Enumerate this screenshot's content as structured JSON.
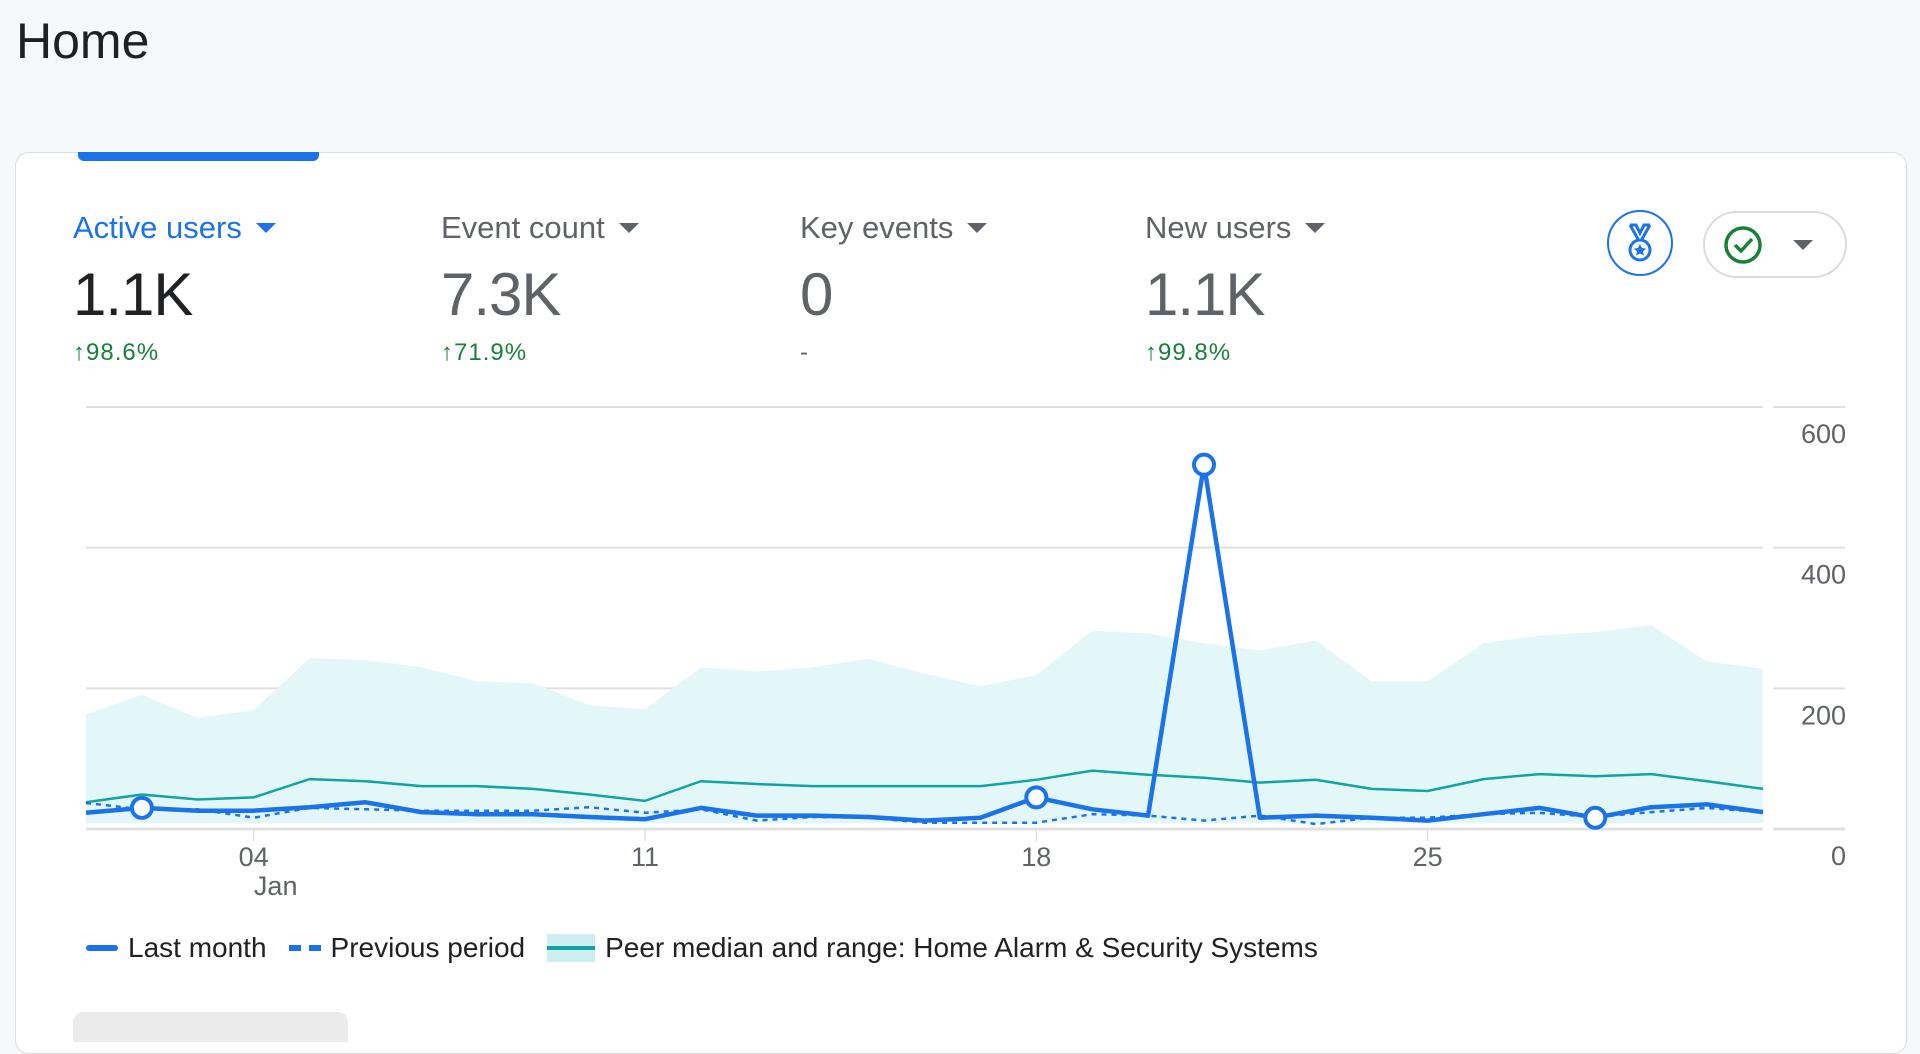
{
  "page": {
    "title": "Home"
  },
  "metrics": [
    {
      "label": "Active users",
      "value": "1.1K",
      "change": "98.6%",
      "direction": "up",
      "active": true
    },
    {
      "label": "Event count",
      "value": "7.3K",
      "change": "71.9%",
      "direction": "up",
      "active": false
    },
    {
      "label": "Key events",
      "value": "0",
      "change": "-",
      "direction": "none",
      "active": false
    },
    {
      "label": "New users",
      "value": "1.1K",
      "change": "99.8%",
      "direction": "up",
      "active": false
    }
  ],
  "toolbar": {
    "medal_icon": "medal-icon",
    "check_icon": "check-circle-icon",
    "dropdown_icon": "caret-down-icon"
  },
  "colors": {
    "accent": "#1a73e8",
    "positive": "#188038",
    "peer_line": "#12a4a4",
    "peer_band": "#e4f7f8"
  },
  "chart_data": {
    "type": "line",
    "x": [
      1,
      2,
      3,
      4,
      5,
      6,
      7,
      8,
      9,
      10,
      11,
      12,
      13,
      14,
      15,
      16,
      17,
      18,
      19,
      20,
      21,
      22,
      23,
      24,
      25,
      26,
      27,
      28,
      29,
      30,
      31
    ],
    "x_ticks": [
      {
        "day": 4,
        "label": "04",
        "sublabel": "Jan"
      },
      {
        "day": 11,
        "label": "11"
      },
      {
        "day": 18,
        "label": "18"
      },
      {
        "day": 25,
        "label": "25"
      }
    ],
    "y_ticks": [
      "0",
      "200",
      "400",
      "600"
    ],
    "ylim": [
      0,
      600
    ],
    "grid": true,
    "legend_position": "bottom",
    "series": [
      {
        "name": "Last month",
        "style": "solid",
        "values": [
          23,
          30,
          26,
          26,
          31,
          38,
          24,
          21,
          21,
          17,
          14,
          30,
          19,
          19,
          17,
          12,
          16,
          45,
          28,
          19,
          518,
          16,
          19,
          16,
          12,
          21,
          30,
          16,
          31,
          35,
          24
        ],
        "marker_days": [
          2,
          18,
          21,
          28
        ]
      },
      {
        "name": "Previous period",
        "style": "dashed",
        "values": [
          37,
          28,
          28,
          16,
          30,
          28,
          26,
          26,
          26,
          31,
          23,
          28,
          12,
          17,
          16,
          9,
          9,
          9,
          21,
          19,
          12,
          19,
          7,
          16,
          16,
          21,
          23,
          17,
          24,
          30,
          24
        ]
      },
      {
        "name": "Peer median and range: Home Alarm & Security Systems",
        "style": "band",
        "median": [
          38,
          49,
          42,
          45,
          71,
          68,
          61,
          61,
          57,
          49,
          40,
          68,
          64,
          61,
          61,
          61,
          61,
          70,
          83,
          77,
          73,
          66,
          70,
          57,
          54,
          71,
          78,
          75,
          78,
          68,
          57
        ],
        "upper": [
          163,
          191,
          158,
          169,
          243,
          240,
          230,
          210,
          207,
          176,
          170,
          230,
          224,
          230,
          242,
          221,
          203,
          219,
          282,
          278,
          264,
          254,
          268,
          210,
          210,
          264,
          275,
          280,
          290,
          238,
          228
        ],
        "lower": [
          8,
          8,
          8,
          8,
          8,
          8,
          8,
          8,
          8,
          8,
          8,
          8,
          8,
          8,
          8,
          8,
          8,
          8,
          8,
          8,
          8,
          8,
          8,
          8,
          8,
          8,
          8,
          8,
          8,
          8,
          8
        ]
      }
    ]
  }
}
